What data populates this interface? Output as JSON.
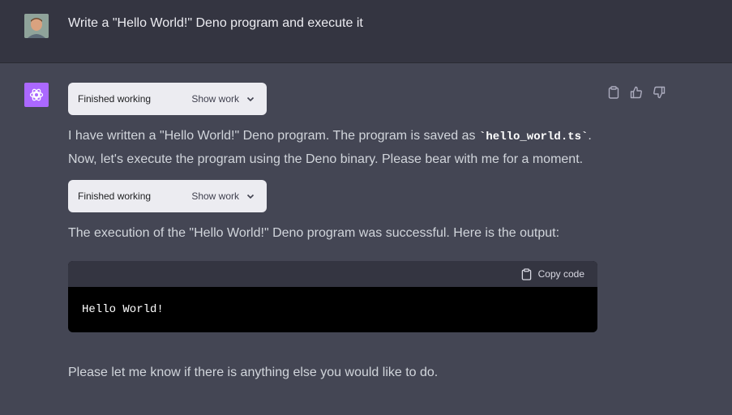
{
  "user_message": {
    "avatar": "user-avatar",
    "text": "Write a \"Hello World!\" Deno program and execute it"
  },
  "assistant": {
    "logo": "openai-logo-icon",
    "work_box_1": {
      "status": "Finished working",
      "toggle_label": "Show work"
    },
    "para_1_before": "I have written a \"Hello World!\" Deno program. The program is saved as ",
    "para_1_code": "`hello_world.ts`",
    "para_1_after": ". Now, let's execute the program using the Deno binary. Please bear with me for a moment.",
    "work_box_2": {
      "status": "Finished working",
      "toggle_label": "Show work"
    },
    "para_2": "The execution of the \"Hello World!\" Deno program was successful. Here is the output:",
    "code": {
      "copy_label": "Copy code",
      "content": "Hello World!"
    },
    "para_3": "Please let me know if there is anything else you would like to do."
  },
  "actions": [
    "clipboard-icon",
    "thumbs-up-icon",
    "thumbs-down-icon"
  ],
  "colors": {
    "logo_bg": "#ab68ff",
    "user_bg": "#343541",
    "assistant_bg": "#444654"
  }
}
